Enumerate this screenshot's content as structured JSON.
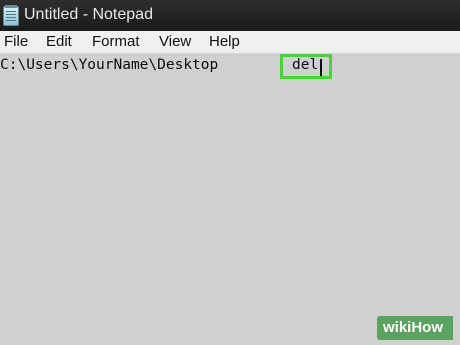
{
  "window": {
    "title": "Untitled - Notepad",
    "icon": "notepad-icon"
  },
  "menu": {
    "items": [
      "File",
      "Edit",
      "Format",
      "View",
      "Help"
    ]
  },
  "editor": {
    "path_text": "C:\\Users\\YourName\\Desktop",
    "typed_text": "del",
    "highlight_color": "#3ddc2a",
    "background_color": "#d0d0d0"
  },
  "watermark": {
    "text": "wikiHow",
    "color": "#58a35f"
  }
}
